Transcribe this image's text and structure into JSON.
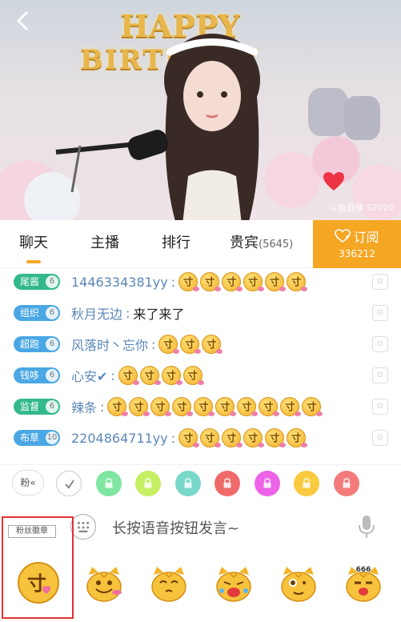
{
  "video": {
    "balloons_top": "HAPPY",
    "balloons_bottom": "BIRTHDAY",
    "watermark": "斗鱼直播 52020"
  },
  "tabs": [
    {
      "label": "聊天",
      "active": true
    },
    {
      "label": "主播",
      "active": false
    },
    {
      "label": "排行",
      "active": false
    },
    {
      "label": "贵宾",
      "count": "(5645)",
      "active": false
    }
  ],
  "subscribe": {
    "label": "订阅",
    "count": "336212"
  },
  "chat": [
    {
      "badge": "尾酱",
      "badge_color": "#33b98a",
      "level": "6",
      "name": "1446334381yy",
      "text": "",
      "emojis": 6
    },
    {
      "badge": "组织",
      "badge_color": "#4aa7e4",
      "level": "6",
      "name": "秋月无边",
      "text": "来了来了",
      "emojis": 0
    },
    {
      "badge": "超跑",
      "badge_color": "#4aa7e4",
      "level": "6",
      "name": "风落时丶忘你",
      "text": "",
      "emojis": 3
    },
    {
      "badge": "钱哆",
      "badge_color": "#4aa7e4",
      "level": "6",
      "name": "心安✔",
      "text": "",
      "emojis": 4
    },
    {
      "badge": "监督",
      "badge_color": "#33b98a",
      "level": "6",
      "name": "辣条",
      "text": "",
      "emojis": 10
    },
    {
      "badge": "布草",
      "badge_color": "#4aa7e4",
      "level": "10",
      "name": "2204864711yy",
      "text": "",
      "emojis": 6
    }
  ],
  "emoji_glyph": "寸",
  "fan_button": "粉«",
  "color_dots": [
    "#8b8b8b",
    "#7ee6a0",
    "#c6ef63",
    "#79d8c9",
    "#f16a6a",
    "#ec63e8",
    "#f9c93e",
    "#f37a7a"
  ],
  "input": {
    "placeholder": "长按语音按钮发言~"
  },
  "emoji_tray": {
    "fan_badge_label": "粉丝徽章",
    "badge_glyph": "寸",
    "extra_label": "666"
  }
}
